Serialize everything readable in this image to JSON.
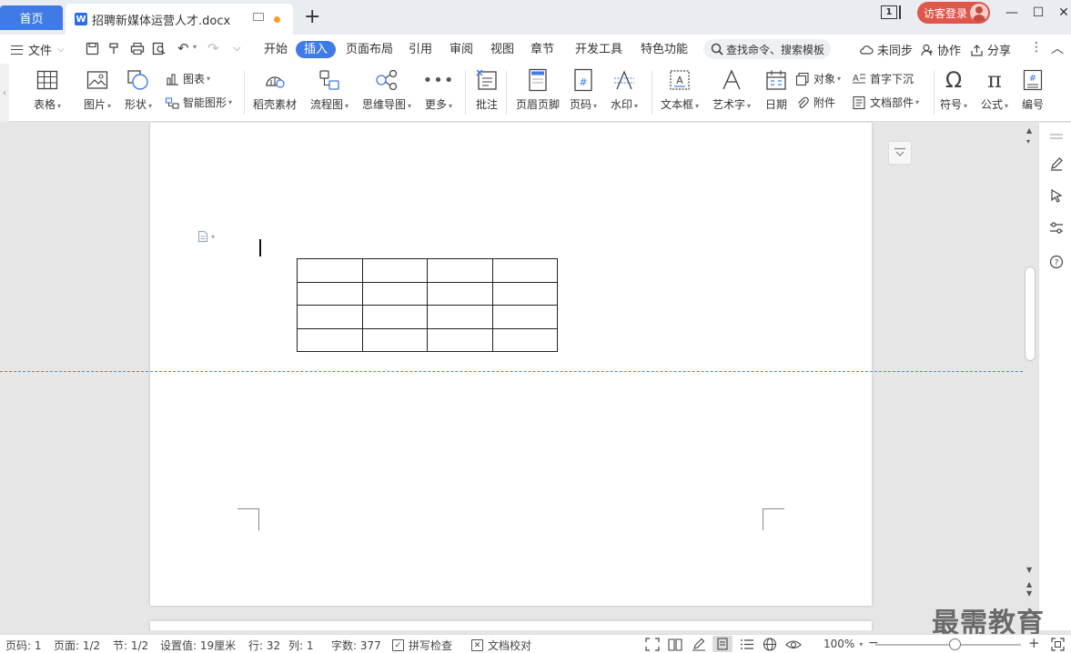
{
  "titlebar": {
    "home_tab": "首页",
    "doc_tab": "招聘新媒体运营人才.docx",
    "new_tab": "+",
    "badge": "1",
    "login": "访客登录",
    "minimize": "—",
    "maximize": "☐",
    "close": "✕"
  },
  "menu": {
    "file": "文件",
    "tabs": [
      "开始",
      "插入",
      "页面布局",
      "引用",
      "审阅",
      "视图",
      "章节",
      "开发工具",
      "特色功能"
    ],
    "active_tab": "插入",
    "search_placeholder": "查找命令、搜索模板",
    "unsync": "未同步",
    "collab": "协作",
    "share": "分享"
  },
  "ribbon": {
    "table": "表格",
    "picture": "图片",
    "shape": "形状",
    "chart": "图表",
    "smart_art": "智能图形",
    "shell_material": "稻壳素材",
    "flowchart": "流程图",
    "mindmap": "思维导图",
    "more": "更多",
    "comment": "批注",
    "header_footer": "页眉页脚",
    "page_number": "页码",
    "watermark": "水印",
    "textbox": "文本框",
    "wordart": "艺术字",
    "date": "日期",
    "object": "对象",
    "attachment": "附件",
    "drop_cap": "首字下沉",
    "doc_parts": "文档部件",
    "symbol": "符号",
    "formula": "公式",
    "numbering": "编号"
  },
  "document": {
    "table_rows": 4,
    "table_cols": 4
  },
  "watermark_text": "最需教育",
  "status": {
    "page": "页码: 1",
    "pages": "页面: 1/2",
    "section": "节: 1/2",
    "setting": "设置值: 19厘米",
    "row": "行: 32",
    "col": "列: 1",
    "wordcount": "字数: 377",
    "spellcheck": "拼写检查",
    "proofread": "文档校对",
    "zoom": "100%"
  }
}
